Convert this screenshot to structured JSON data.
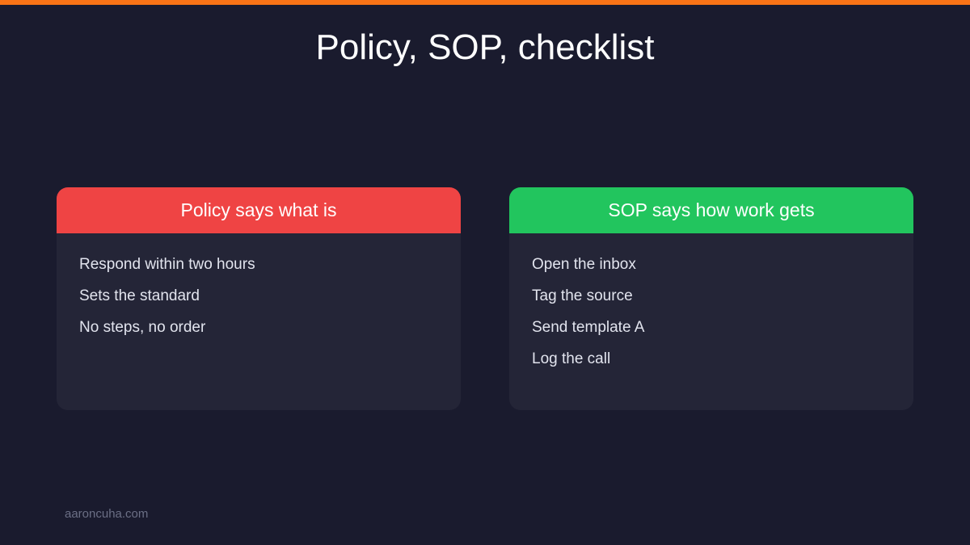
{
  "slide": {
    "title": "Policy, SOP, checklist",
    "accent_color": "#f97316",
    "background_color": "#1a1b2e"
  },
  "cards": [
    {
      "header": "Policy says what is",
      "header_color": "#ef4444",
      "items": [
        "Respond within two hours",
        "Sets the standard",
        "No steps, no order"
      ]
    },
    {
      "header": "SOP says how work gets",
      "header_color": "#22c55e",
      "items": [
        "Open the inbox",
        "Tag the source",
        "Send template A",
        "Log the call"
      ]
    }
  ],
  "footer": {
    "text": "aaroncuha.com"
  }
}
